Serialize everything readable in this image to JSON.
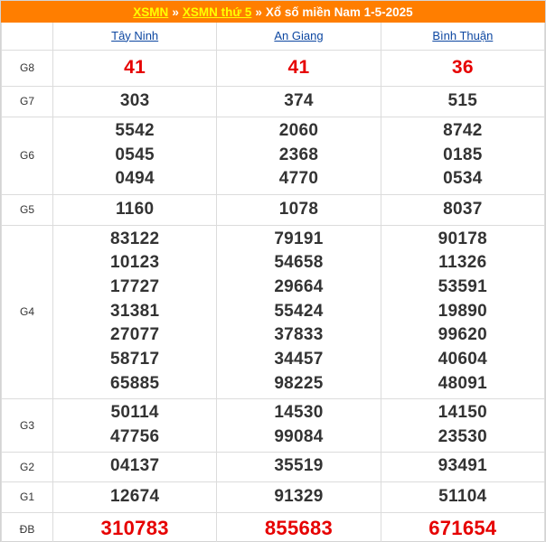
{
  "breadcrumb": {
    "link1": "XSMN",
    "sep1": "»",
    "link2": "XSMN thứ 5",
    "sep2": "»",
    "title": "Xổ số miền Nam 1-5-2025"
  },
  "provinces": [
    "Tây Ninh",
    "An Giang",
    "Bình Thuận"
  ],
  "rows": [
    {
      "label": "G8",
      "values": [
        [
          "41"
        ],
        [
          "41"
        ],
        [
          "36"
        ]
      ]
    },
    {
      "label": "G7",
      "values": [
        [
          "303"
        ],
        [
          "374"
        ],
        [
          "515"
        ]
      ]
    },
    {
      "label": "G6",
      "values": [
        [
          "5542",
          "0545",
          "0494"
        ],
        [
          "2060",
          "2368",
          "4770"
        ],
        [
          "8742",
          "0185",
          "0534"
        ]
      ]
    },
    {
      "label": "G5",
      "values": [
        [
          "1160"
        ],
        [
          "1078"
        ],
        [
          "8037"
        ]
      ]
    },
    {
      "label": "G4",
      "values": [
        [
          "83122",
          "10123",
          "17727",
          "31381",
          "27077",
          "58717",
          "65885"
        ],
        [
          "79191",
          "54658",
          "29664",
          "55424",
          "37833",
          "34457",
          "98225"
        ],
        [
          "90178",
          "11326",
          "53591",
          "19890",
          "99620",
          "40604",
          "48091"
        ]
      ]
    },
    {
      "label": "G3",
      "values": [
        [
          "50114",
          "47756"
        ],
        [
          "14530",
          "99084"
        ],
        [
          "14150",
          "23530"
        ]
      ]
    },
    {
      "label": "G2",
      "values": [
        [
          "04137"
        ],
        [
          "35519"
        ],
        [
          "93491"
        ]
      ]
    },
    {
      "label": "G1",
      "values": [
        [
          "12674"
        ],
        [
          "91329"
        ],
        [
          "51104"
        ]
      ]
    },
    {
      "label": "ĐB",
      "values": [
        [
          "310783"
        ],
        [
          "855683"
        ],
        [
          "671654"
        ]
      ]
    }
  ],
  "colors": {
    "header_bg": "#ff7e00",
    "link_yellow": "#ffff00",
    "province_link": "#0d47a1",
    "prize_red": "#e60000"
  }
}
